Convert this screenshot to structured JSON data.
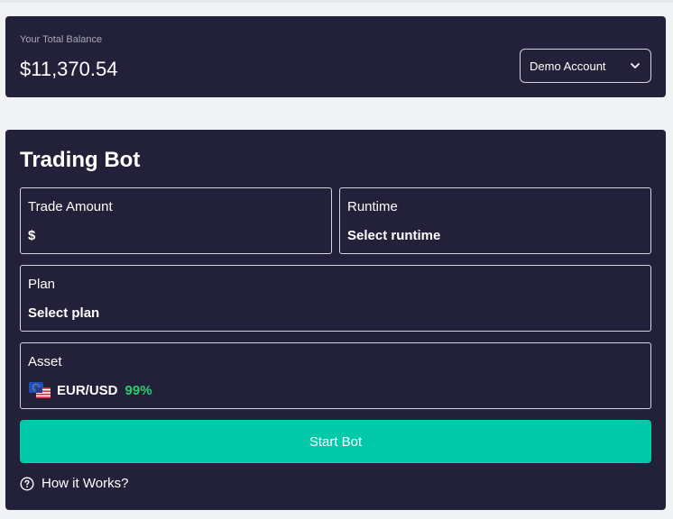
{
  "balance": {
    "label": "Your Total Balance",
    "value": "$11,370.54",
    "account_select": "Demo Account"
  },
  "bot": {
    "title": "Trading Bot",
    "trade_amount": {
      "label": "Trade Amount",
      "value": "$"
    },
    "runtime": {
      "label": "Runtime",
      "value": "Select runtime"
    },
    "plan": {
      "label": "Plan",
      "value": "Select plan"
    },
    "asset": {
      "label": "Asset",
      "name": "EUR/USD",
      "payout": "99%"
    },
    "start_button": "Start Bot",
    "how_it_works": "How it Works?"
  },
  "icons": {
    "chevron": "chevron-down-icon",
    "flags": "eur-usd-flags-icon",
    "help": "help-circle-icon"
  },
  "colors": {
    "card_bg": "#23213a",
    "accent": "#03c9ab",
    "payout_green": "#2ecc71",
    "page_bg": "#f1f2f4"
  }
}
